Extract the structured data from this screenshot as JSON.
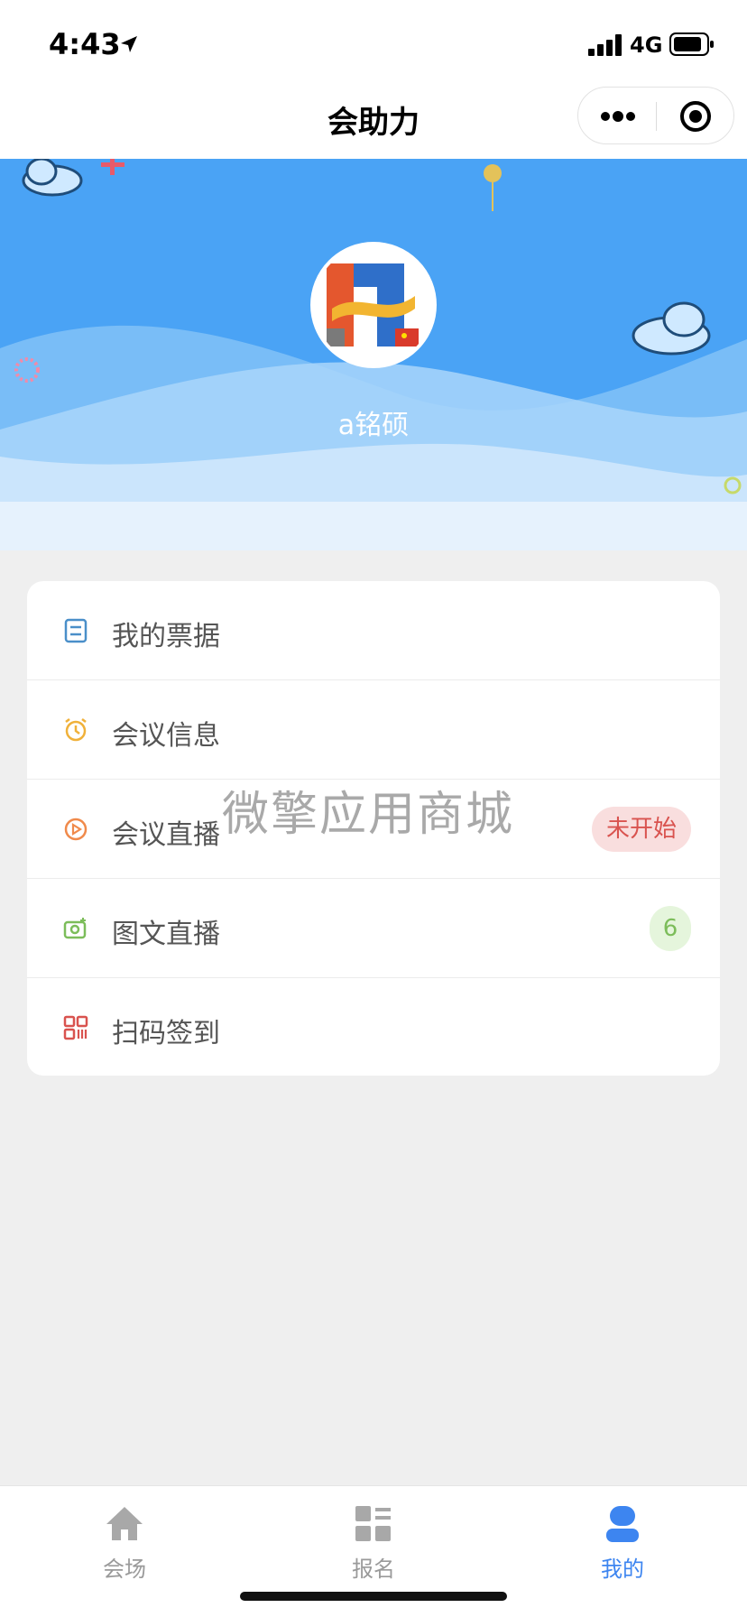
{
  "status_bar": {
    "time": "4:43",
    "network": "4G"
  },
  "nav": {
    "title": "会助力"
  },
  "profile": {
    "username": "a铭硕"
  },
  "menu": {
    "items": [
      {
        "label": "我的票据",
        "icon": "ticket-icon",
        "color": "#4a8fc9"
      },
      {
        "label": "会议信息",
        "icon": "alarm-clock-icon",
        "color": "#f0b13a"
      },
      {
        "label": "会议直播",
        "icon": "play-circle-icon",
        "color": "#f08a4b",
        "badge": "未开始"
      },
      {
        "label": "图文直播",
        "icon": "camera-icon",
        "color": "#7cbd5a",
        "count": "6"
      },
      {
        "label": "扫码签到",
        "icon": "qr-code-icon",
        "color": "#d9534f"
      }
    ]
  },
  "watermark": "微擎应用商城",
  "tabs": [
    {
      "label": "会场",
      "icon": "home-icon",
      "active": false
    },
    {
      "label": "报名",
      "icon": "grid-list-icon",
      "active": false
    },
    {
      "label": "我的",
      "icon": "user-icon",
      "active": true
    }
  ],
  "colors": {
    "accent": "#3d85f0",
    "banner_blue": "#4aa3f5"
  }
}
